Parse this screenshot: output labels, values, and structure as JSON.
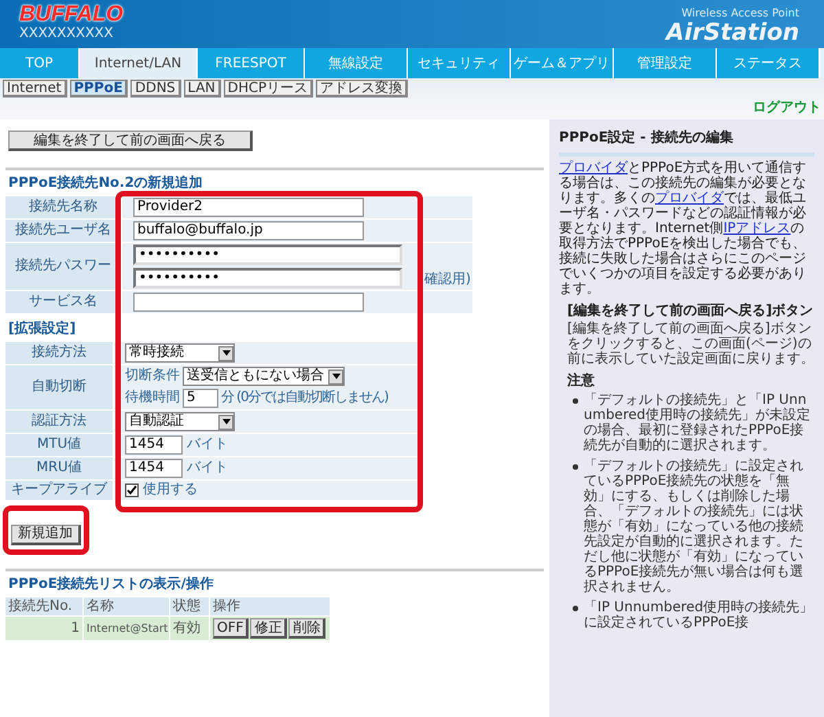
{
  "header": {
    "logo": "BUFFALO",
    "model": "XXXXXXXXXX",
    "product_sub": "Wireless Access Point",
    "product": "AirStation"
  },
  "nav": [
    {
      "label": "TOP",
      "selected": false
    },
    {
      "label": "Internet/LAN",
      "selected": true
    },
    {
      "label": "FREESPOT",
      "selected": false
    },
    {
      "label": "無線設定",
      "selected": false
    },
    {
      "label": "セキュリティ",
      "selected": false
    },
    {
      "label": "ゲーム＆アプリ",
      "selected": false
    },
    {
      "label": "管理設定",
      "selected": false
    },
    {
      "label": "ステータス",
      "selected": false
    }
  ],
  "subnav": [
    {
      "label": "Internet",
      "selected": false
    },
    {
      "label": "PPPoE",
      "selected": true
    },
    {
      "label": "DDNS",
      "selected": false
    },
    {
      "label": "LAN",
      "selected": false
    },
    {
      "label": "DHCPリース",
      "selected": false
    },
    {
      "label": "アドレス変換",
      "selected": false
    }
  ],
  "logout": "ログアウト",
  "back_button": "編集を終了して前の画面へ戻る",
  "form_title": "PPPoE接続先No.2の新規追加",
  "fields": [
    {
      "kind": "text",
      "label": "接続先名称",
      "value": "Provider2"
    },
    {
      "kind": "text",
      "label": "接続先ユーザ名",
      "value": "buffalo@buffalo.jp"
    },
    {
      "kind": "password",
      "label": "接続先パスワー",
      "values": [
        "••••••••••",
        "••••••••••"
      ],
      "note": "確認用)"
    },
    {
      "kind": "text",
      "label": "サービス名"
    }
  ],
  "ext_title": "[拡張設定]",
  "ext_fields": [
    {
      "kind": "select",
      "label": "接続方法",
      "value": "常時接続"
    },
    {
      "kind": "auto_disconnect",
      "label": "自動切断",
      "condition_label": "切断条件",
      "condition_value": "送受信ともにない場合",
      "wait_label": "待機時間",
      "wait_value": "5",
      "wait_note": "分 (0分では自動切断しません)"
    },
    {
      "kind": "select",
      "label": "認証方法",
      "value": "自動認証"
    },
    {
      "kind": "unit",
      "label": "MTU値",
      "value": "1454",
      "unit": "バイト"
    },
    {
      "kind": "unit",
      "label": "MRU値",
      "value": "1454",
      "unit": "バイト"
    },
    {
      "kind": "checkbox",
      "label": "キープアライブ",
      "checked": true,
      "text": "使用する"
    }
  ],
  "add_button": "新規追加",
  "list_title": "PPPoE接続先リストの表示/操作",
  "list": {
    "columns": [
      "接続先No.",
      "名称",
      "状態",
      "操作"
    ],
    "rows": [
      {
        "no": "1",
        "name": "Internet@Start",
        "status": "有効",
        "actions": [
          "OFF",
          "修正",
          "削除"
        ]
      }
    ]
  },
  "sidebar": {
    "title": "PPPoE設定 - 接続先の編集",
    "paragraph": [
      {
        "text": "プロバイダ",
        "link": true
      },
      {
        "text": "とPPPoE方式を用いて通信する場合は、この接続先の編集が必要となります。多くの",
        "link": false
      },
      {
        "text": "プロバイダ",
        "link": true
      },
      {
        "text": "では、最低ユーザ名・パスワードなどの認証情報が必要となります。Internet側",
        "link": false
      },
      {
        "text": "IPアドレス",
        "link": true
      },
      {
        "text": "の取得方法でPPPoEを検出した場合でも、接続に失敗した場合はさらにこのページでいくつかの項目を設定する必要があります。",
        "link": false
      }
    ],
    "button_heading": "[編集を終了して前の画面へ戻る]ボタン",
    "button_desc": "[編集を終了して前の画面へ戻る]ボタンをクリックすると、この画面(ページ)の前に表示していた設定画面に戻ります。",
    "note_title": "注意",
    "notes": [
      "「デフォルトの接続先」と「IP Unnumbered使用時の接続先」が未設定の場合、最初に登録されたPPPoE接続先が自動的に選択されます。",
      "「デフォルトの接続先」に設定されているPPPoE接続先の状態を「無効」にする、もしくは削除した場合、「デフォルトの接続先」には状態が「有効」になっている他の接続先設定が自動的に選択されます。ただし他に状態が「有効」になっているPPPoE接続先が無い場合は何も選択されません。",
      "「IP Unnumbered使用時の接続先」に設定されているPPPoE接"
    ]
  }
}
